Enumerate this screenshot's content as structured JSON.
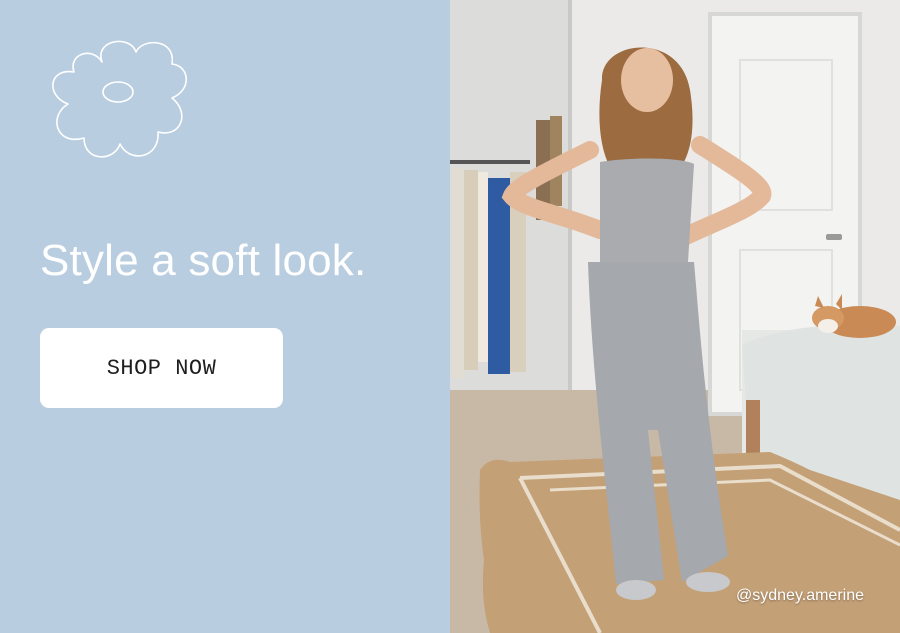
{
  "promo": {
    "headline": "Style a soft look.",
    "cta_label": "SHOP NOW",
    "photo_credit": "@sydney.amerine",
    "logo_icon": "flower-outline-icon",
    "background_color": "#b9cde0",
    "button_color": "#ffffff",
    "text_color": "#ffffff"
  }
}
